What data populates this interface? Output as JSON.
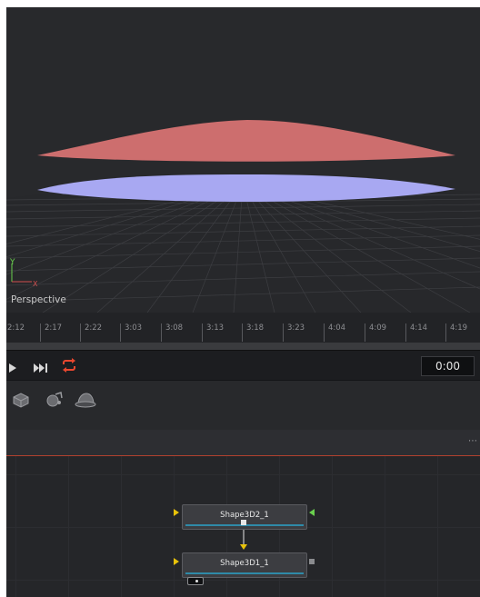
{
  "viewer": {
    "view_label": "Perspective",
    "axis_y": "Y",
    "axis_x": "X"
  },
  "ruler": {
    "ticks": [
      "2:12",
      "2:17",
      "2:22",
      "3:03",
      "3:08",
      "3:13",
      "3:18",
      "3:23",
      "4:04",
      "4:09",
      "4:14",
      "4:19"
    ]
  },
  "transport": {
    "timecode": "0:00",
    "loop_color": "#e8472f"
  },
  "node_editor": {
    "more_label": "⋯",
    "nodes": [
      {
        "label": "Shape3D2_1"
      },
      {
        "label": "Shape3D1_1"
      }
    ]
  },
  "colors": {
    "upper_shape": "#cd6e6e",
    "lower_shape": "#a8a8f2",
    "accent_line": "#b3412f",
    "node_bar": "#2f8aa8"
  }
}
